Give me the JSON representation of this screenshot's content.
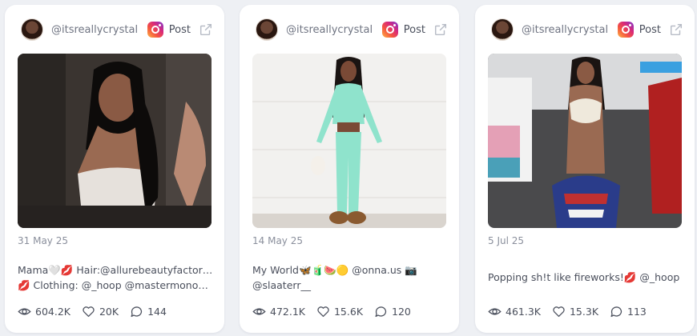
{
  "posts": [
    {
      "handle": "@itsreallycrystal",
      "platform": "Post",
      "date": "31 May 25",
      "caption_line1": "Mama🤍💋 Hair:@allurebeautyfactory😩",
      "caption_line2": "💋 Clothing: @_hoop @mastermonocle…",
      "views": "604.2K",
      "likes": "20K",
      "comments": "144"
    },
    {
      "handle": "@itsreallycrystal",
      "platform": "Post",
      "date": "14 May 25",
      "caption_line1": "My World🦋🧃🍉🟡 @onna.us 📷",
      "caption_line2": "@slaaterr__",
      "views": "472.1K",
      "likes": "15.6K",
      "comments": "120"
    },
    {
      "handle": "@itsreallycrystal",
      "platform": "Post",
      "date": "5 Jul 25",
      "caption_line1": "Popping sh!t like fireworks!💋 @_hoop",
      "views": "461.3K",
      "likes": "15.3K",
      "comments": "113"
    }
  ],
  "colors": {
    "background": "#eef0f4",
    "card": "#ffffff",
    "text": "#4a4f5c",
    "muted": "#8a8f9c"
  },
  "icons": [
    "instagram-icon",
    "external-link-icon",
    "eye-icon",
    "heart-icon",
    "comment-icon"
  ]
}
